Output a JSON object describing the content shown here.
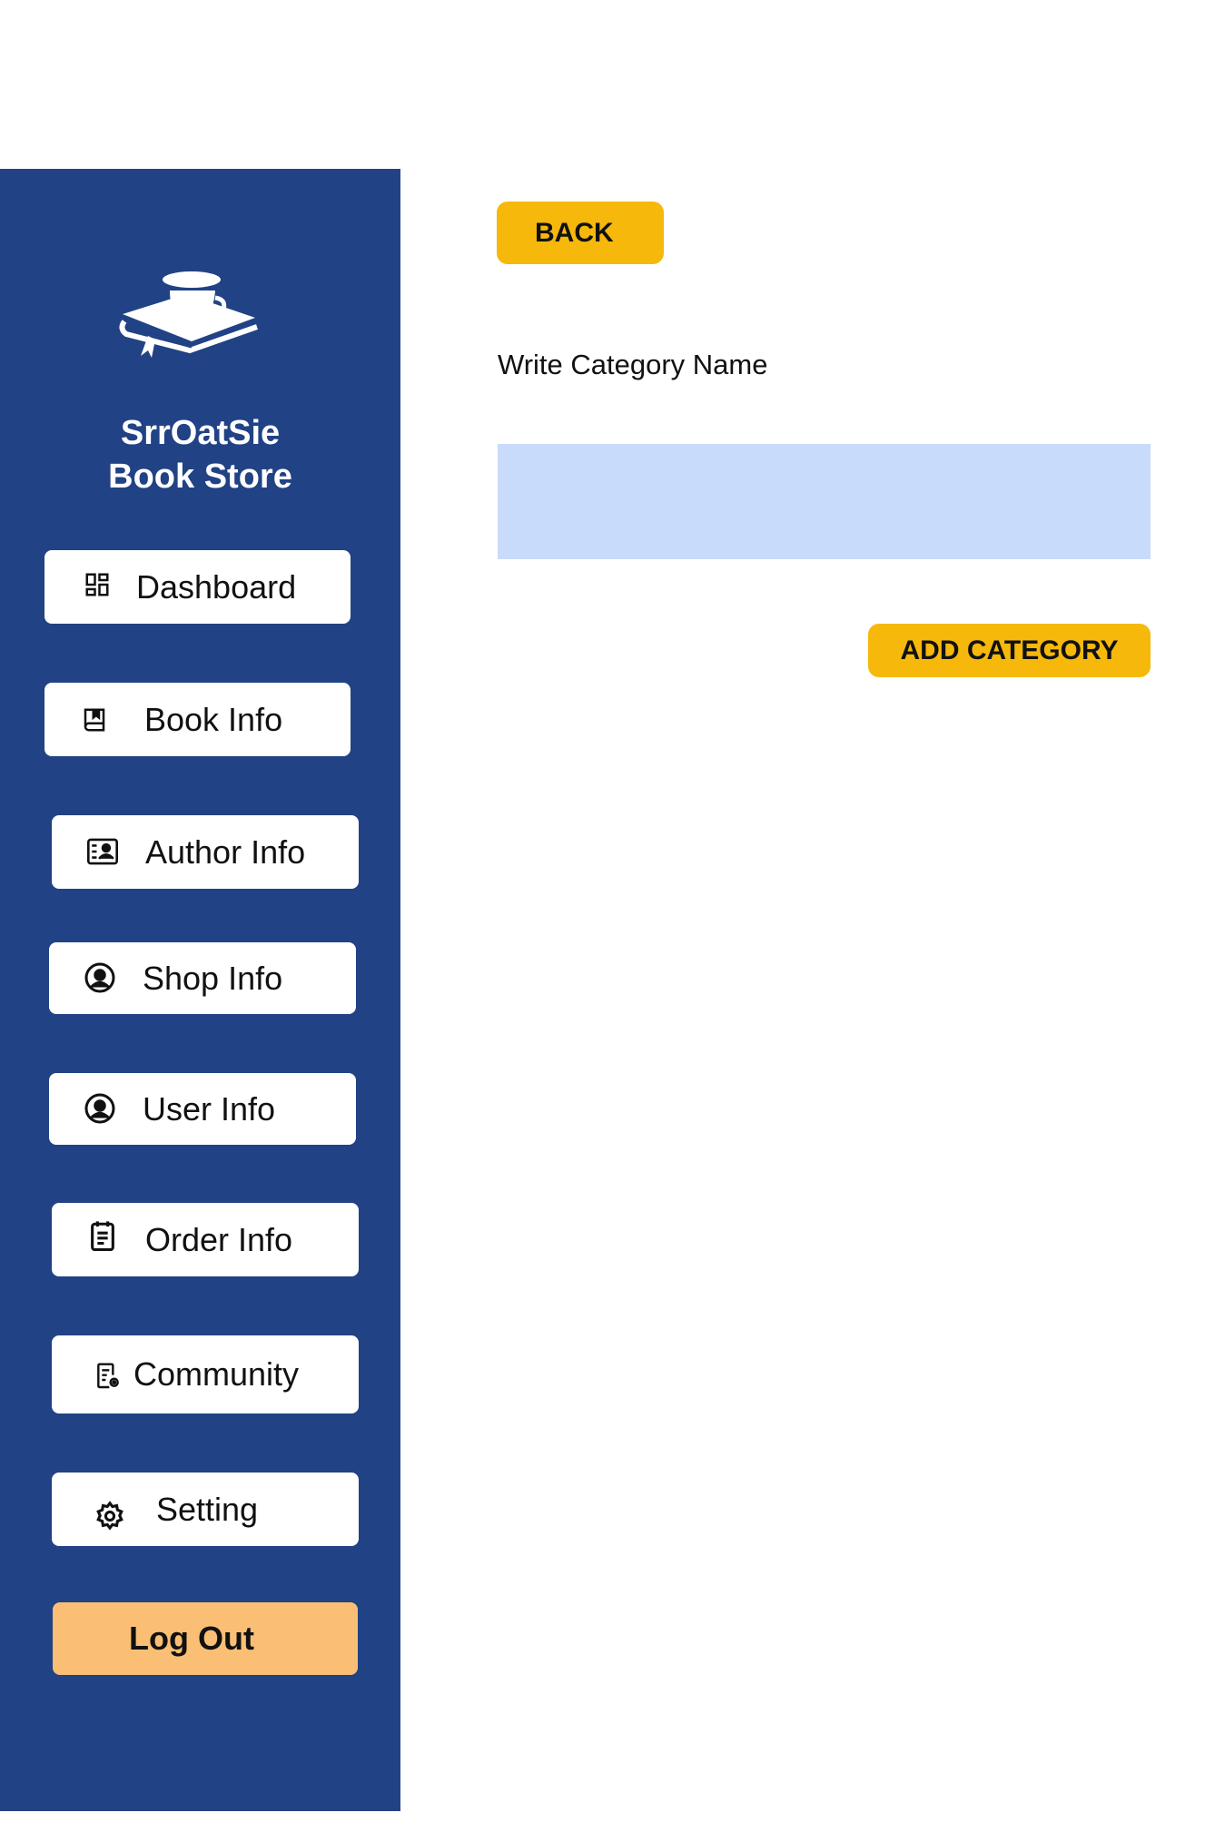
{
  "brand": {
    "line1": "SrrOatSie",
    "line2": "Book Store",
    "logo_icon": "book-cup-icon"
  },
  "sidebar": {
    "items": [
      {
        "label": "Dashboard",
        "icon": "dashboard-icon"
      },
      {
        "label": "Book Info",
        "icon": "book-icon"
      },
      {
        "label": "Author Info",
        "icon": "contact-card-icon"
      },
      {
        "label": "Shop Info",
        "icon": "user-circle-icon"
      },
      {
        "label": "User Info",
        "icon": "user-circle-icon"
      },
      {
        "label": "Order Info",
        "icon": "clipboard-icon"
      },
      {
        "label": "Community",
        "icon": "document-settings-icon"
      },
      {
        "label": "Setting",
        "icon": "gear-icon"
      }
    ],
    "logout_label": "Log Out"
  },
  "main": {
    "back_label": "BACK",
    "field_label": "Write Category Name",
    "field_value": "",
    "add_label": "ADD CATEGORY"
  },
  "colors": {
    "sidebar_bg": "#214285",
    "accent_button": "#f6b80b",
    "logout_button": "#fabf75",
    "input_bg": "#c9dbfb"
  }
}
